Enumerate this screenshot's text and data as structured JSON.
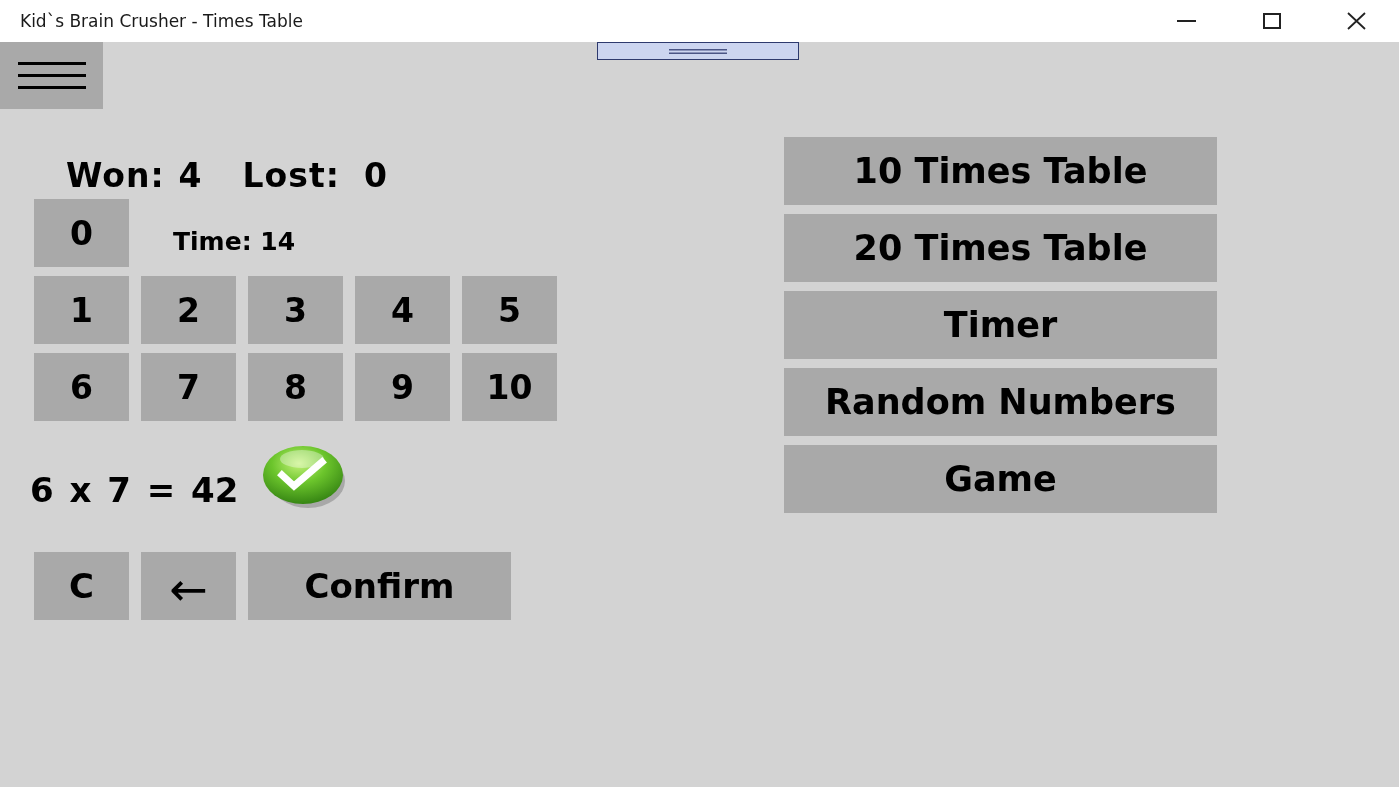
{
  "window": {
    "title": "Kid`s Brain Crusher - Times Table"
  },
  "score": {
    "won_label": "Won:",
    "won": "4",
    "lost_label": "Lost:",
    "lost": "0"
  },
  "timer": "Time: 14",
  "keypad_rows": [
    [
      "0"
    ],
    [
      "1",
      "2",
      "3",
      "4",
      "5"
    ],
    [
      "6",
      "7",
      "8",
      "9",
      "10"
    ]
  ],
  "equation": {
    "text": "6 x 7 = 42",
    "correct": true
  },
  "actions": [
    {
      "label": "C",
      "kind": "clear"
    },
    {
      "label": "←",
      "kind": "backspace"
    },
    {
      "label": "Confirm",
      "kind": "confirm"
    }
  ],
  "modes": [
    "10 Times Table",
    "20 Times Table",
    "Timer",
    "Random Numbers",
    "Game"
  ]
}
